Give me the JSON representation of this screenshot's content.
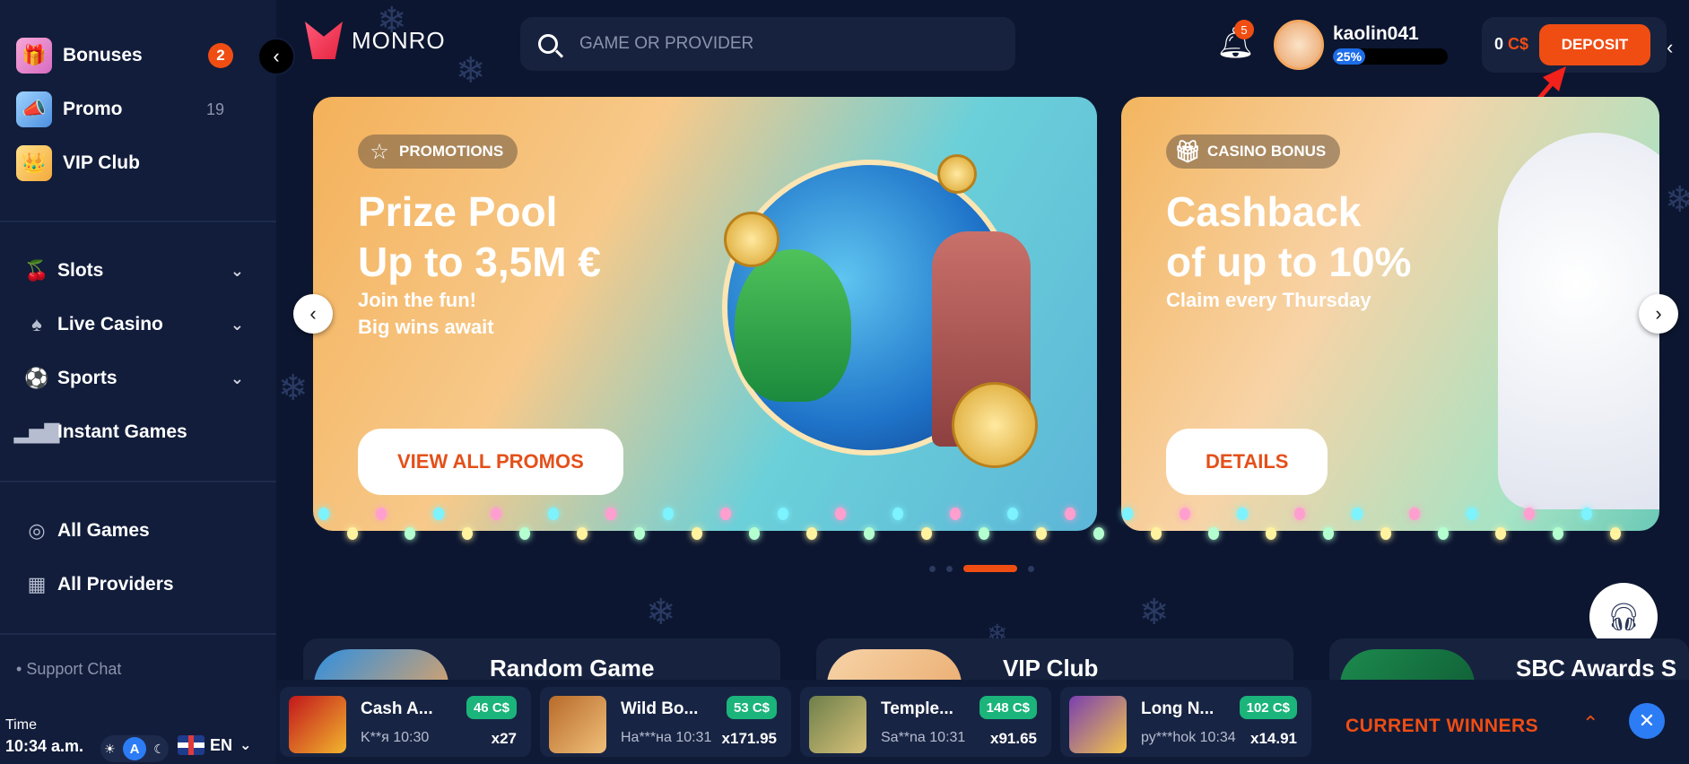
{
  "sidebar": {
    "top_items": [
      {
        "label": "Bonuses",
        "badge": "2",
        "icon": "gift-icon"
      },
      {
        "label": "Promo",
        "count": "19",
        "icon": "megaphone-icon"
      },
      {
        "label": "VIP Club",
        "icon": "crown-icon"
      }
    ],
    "nav_items": [
      {
        "label": "Slots",
        "icon": "cherries-icon"
      },
      {
        "label": "Live Casino",
        "icon": "dealer-icon"
      },
      {
        "label": "Sports",
        "icon": "ball-icon"
      },
      {
        "label": "Instant Games",
        "icon": "chart-bars-icon"
      }
    ],
    "game_items": [
      {
        "label": "All Games",
        "icon": "compass-icon"
      },
      {
        "label": "All Providers",
        "icon": "grid-icon"
      }
    ],
    "support_label": "Support Chat",
    "time_label": "Time",
    "time_value": "10:34 a.m.",
    "theme_mode": "A",
    "language": "EN"
  },
  "header": {
    "logo_text": "MONRO",
    "search_placeholder": "GAME OR PROVIDER",
    "notifications": "5",
    "username": "kaolin041",
    "level_percent": "25%",
    "level_fraction": 0.25,
    "balance_amount": "0",
    "balance_currency": "C$",
    "deposit_label": "DEPOSIT"
  },
  "banners": [
    {
      "tag": "PROMOTIONS",
      "title_line1": "Prize Pool",
      "title_line2": "Up to 3,5M €",
      "sub_line1": "Join the fun!",
      "sub_line2": "Big wins await",
      "button": "VIEW ALL PROMOS"
    },
    {
      "tag": "CASINO BONUS",
      "title_line1": "Cashback",
      "title_line2": "of up to 10%",
      "sub_line1": "Claim every Thursday",
      "button": "DETAILS"
    }
  ],
  "features": [
    {
      "title": "Random Game"
    },
    {
      "title": "VIP Club"
    },
    {
      "title": "SBC Awards S"
    }
  ],
  "winners": {
    "items": [
      {
        "game": "Cash A...",
        "amount": "46 C$",
        "user": "K**я 10:30",
        "multiplier": "x27"
      },
      {
        "game": "Wild Bo...",
        "amount": "53 C$",
        "user": "На***на 10:31",
        "multiplier": "x171.95"
      },
      {
        "game": "Temple...",
        "amount": "148 C$",
        "user": "Sa**na 10:31",
        "multiplier": "x91.65"
      },
      {
        "game": "Long N...",
        "amount": "102 C$",
        "user": "ру***hok 10:34",
        "multiplier": "x14.91"
      }
    ],
    "label": "CURRENT WINNERS"
  },
  "colors": {
    "accent": "#f04d13",
    "background": "#0c1630",
    "sidebar": "#121d3b",
    "win_badge": "#1bb47b",
    "primary_blue": "#2c7cf5"
  }
}
